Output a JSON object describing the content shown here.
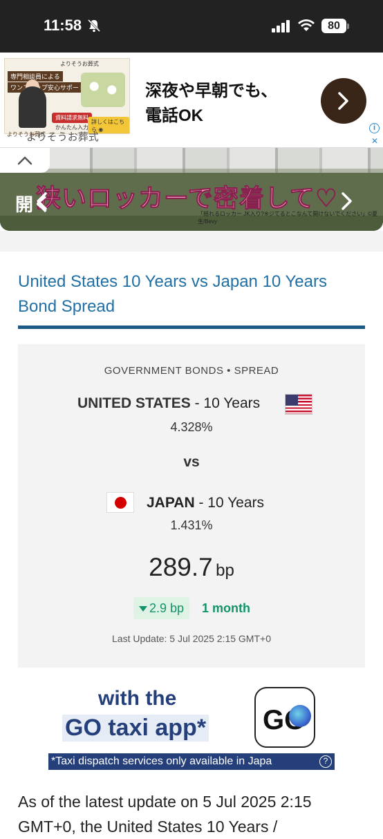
{
  "status_bar": {
    "time": "11:58",
    "battery": "80"
  },
  "ad_banner": {
    "thumb_top": "よりそうお葬式",
    "thumb_tag1": "専門相談員による",
    "thumb_tag2": "ワンストップ安心サポート",
    "thumb_btn1": "資料請求無料",
    "thumb_btn1_sub": "かんたん入力45秒",
    "thumb_btn2": "詳しくはこちら ◉",
    "headline_line1": "深夜や早朝でも、",
    "headline_line2": "電話OK",
    "brand": "よりそうお葬式",
    "brand_logo": "よりそうお葬式"
  },
  "manga_banner": {
    "title": "狭いロッカーで密着して♡",
    "caption": "「揺れるロッカー JK入り?※ジてるとこなんて開けないでください」©夏生/Bevy",
    "open_label": "開く"
  },
  "page": {
    "title": "United States 10 Years vs Japan 10 Years Bond Spread"
  },
  "spread_card": {
    "kicker": "GOVERNMENT BONDS • SPREAD",
    "us_name": "UNITED STATES",
    "us_term": " - 10 Years",
    "us_rate": "4.328%",
    "vs": "vs",
    "jp_name": "JAPAN",
    "jp_term": " - 10 Years",
    "jp_rate": "1.431%",
    "spread_value": "289.7",
    "spread_unit": "bp",
    "change": "2.9 bp",
    "change_period": "1 month",
    "last_update": "Last Update: 5 Jul 2025 2:15 GMT+0",
    "colors": {
      "positive": "#12936a",
      "title": "#1f6fa5"
    }
  },
  "taxi_ad": {
    "line1": "with the",
    "line2": "GO taxi app*",
    "logo": "GO",
    "note": "*Taxi dispatch services only available in Japa"
  },
  "summary": {
    "text": "As of the latest update on 5 Jul 2025 2:15 GMT+0, the United States 10 Years /"
  }
}
